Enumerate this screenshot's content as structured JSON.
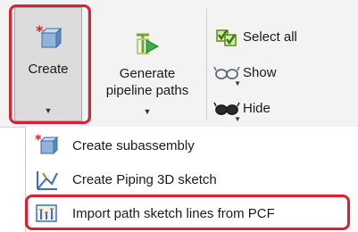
{
  "ribbon": {
    "create": {
      "label": "Create",
      "icon": "create-part-icon"
    },
    "generate": {
      "label_line1": "Generate",
      "label_line2": "pipeline paths",
      "icon": "pipeline-path-icon"
    },
    "select_all": {
      "label": "Select all",
      "icon": "select-all-icon"
    },
    "show": {
      "label": "Show",
      "icon": "glasses-show-icon"
    },
    "hide": {
      "label": "Hide",
      "icon": "glasses-hide-icon"
    }
  },
  "dropdown": {
    "items": [
      {
        "label": "Create subassembly",
        "icon": "subassembly-icon"
      },
      {
        "label": "Create Piping 3D sketch",
        "icon": "sketch-3d-icon"
      },
      {
        "label": "Import path sketch lines from PCF",
        "icon": "import-pcf-icon"
      }
    ]
  },
  "colors": {
    "highlight": "#e01e2f",
    "ribbon_bg": "#f3f3f3",
    "pressed_bg": "#dcdcdc"
  }
}
